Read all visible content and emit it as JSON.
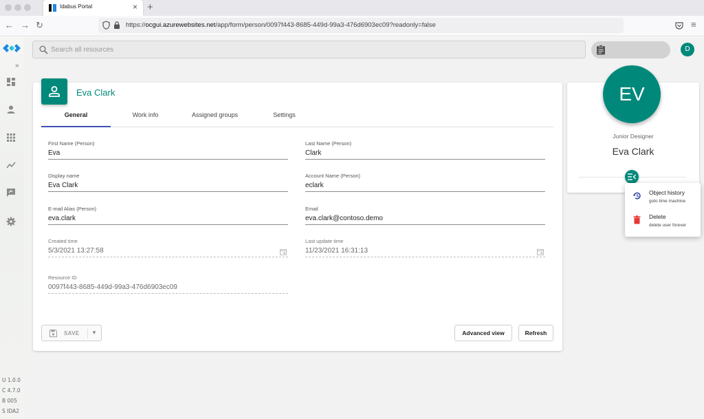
{
  "browser": {
    "tab_title": "Idabus Portal",
    "tab_close": "×",
    "new_tab": "+",
    "url_prefix": "https://",
    "url_host": "ocgui.azurewebsites.net",
    "url_path": "/app/form/person/0097f443-8685-449d-99a3-476d6903ec09?readonly=false"
  },
  "search": {
    "placeholder": "Search all resources"
  },
  "user": {
    "initial": "D"
  },
  "sidebar": {
    "expand": "»",
    "versions": [
      "U 1.0.0",
      "C 4.7.0",
      "B 005",
      "S IDA2"
    ]
  },
  "card": {
    "title": "Eva Clark",
    "tabs": [
      "General",
      "Work info",
      "Assigned groups",
      "Settings"
    ],
    "fields": {
      "first_name": {
        "label": "First Name (Person)",
        "value": "Eva"
      },
      "last_name": {
        "label": "Last Name (Person)",
        "value": "Clark"
      },
      "display_name": {
        "label": "Display name",
        "value": "Eva Clark"
      },
      "account_name": {
        "label": "Account Name (Person)",
        "value": "eclark"
      },
      "email_alias": {
        "label": "E-mail Alias (Person)",
        "value": "eva.clark"
      },
      "email": {
        "label": "Email",
        "value": "eva.clark@contoso.demo"
      },
      "created_time": {
        "label": "Created time",
        "value": "5/3/2021 13:27:58"
      },
      "last_update_time": {
        "label": "Last update time",
        "value": "11/23/2021 16:31:13"
      },
      "resource_id": {
        "label": "Resource ID",
        "value": "0097f443-8685-449d-99a3-476d6903ec09"
      }
    },
    "buttons": {
      "save": "SAVE",
      "advanced": "Advanced view",
      "refresh": "Refresh"
    }
  },
  "profile": {
    "initials": "EV",
    "role": "Junior Designer",
    "name": "Eva Clark",
    "menu": [
      {
        "title": "Object history",
        "subtitle": "goto time machine"
      },
      {
        "title": "Delete",
        "subtitle": "delete user forever"
      }
    ]
  },
  "colors": {
    "accent": "#00897b",
    "tab_indicator": "#3f51b5",
    "delete": "#e53935",
    "history": "#3949ab"
  }
}
